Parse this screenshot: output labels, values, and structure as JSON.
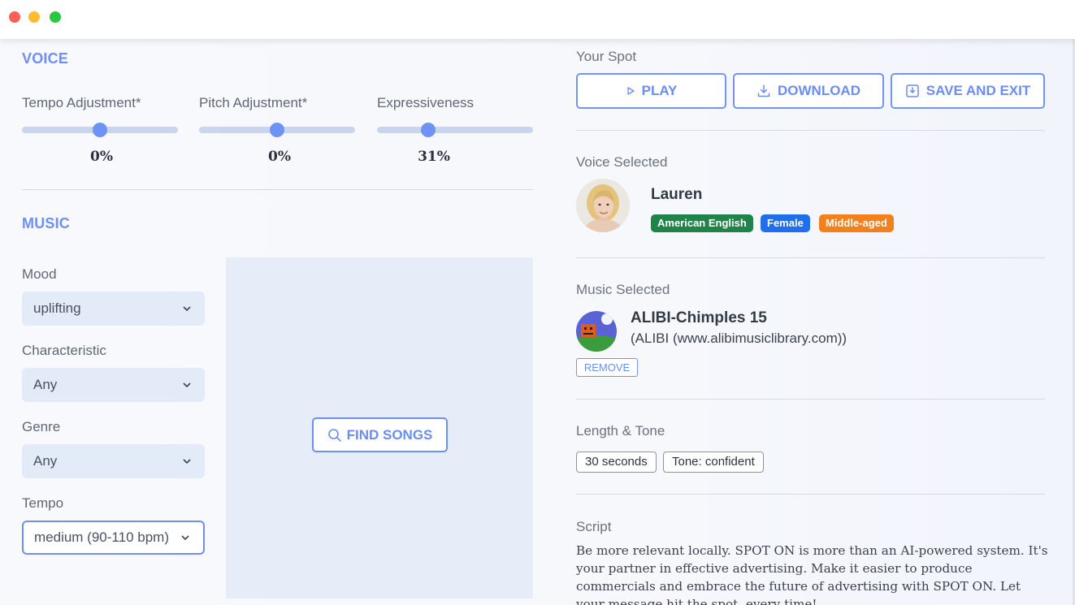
{
  "window": {
    "controls": [
      "close",
      "minimize",
      "maximize"
    ]
  },
  "voice": {
    "title": "VOICE",
    "sliders": [
      {
        "label": "Tempo Adjustment*",
        "value_text": "0%",
        "value": 0.5
      },
      {
        "label": "Pitch Adjustment*",
        "value_text": "0%",
        "value": 0.5
      },
      {
        "label": "Expressiveness",
        "value_text": "31%",
        "value": 0.33
      }
    ]
  },
  "music": {
    "title": "MUSIC",
    "fields": [
      {
        "label": "Mood",
        "value": "uplifting"
      },
      {
        "label": "Characteristic",
        "value": "Any"
      },
      {
        "label": "Genre",
        "value": "Any"
      },
      {
        "label": "Tempo",
        "value": "medium (90-110 bpm)"
      }
    ],
    "find_songs_label": "FIND SONGS"
  },
  "spot": {
    "title": "Your Spot",
    "play_label": "PLAY",
    "download_label": "DOWNLOAD",
    "save_label": "SAVE AND EXIT"
  },
  "voice_selected": {
    "label": "Voice Selected",
    "name": "Lauren",
    "tags": [
      {
        "text": "American English",
        "color": "#1e8449"
      },
      {
        "text": "Female",
        "color": "#1f6feb"
      },
      {
        "text": "Middle-aged",
        "color": "#f2801c"
      }
    ]
  },
  "music_selected": {
    "label": "Music Selected",
    "title": "ALIBI-Chimples 15",
    "source": "(ALIBI (www.alibimusiclibrary.com))",
    "remove_label": "REMOVE"
  },
  "length_tone": {
    "label": "Length & Tone",
    "length": "30 seconds",
    "tone": "Tone: confident"
  },
  "script": {
    "label": "Script",
    "text": "Be more relevant locally. SPOT ON is more than an AI-powered system. It's your partner in effective advertising. Make it easier to produce commercials and embrace the future of advertising with SPOT ON. Let your message hit the spot, every time!"
  },
  "colors": {
    "accent": "#6e8ff0",
    "section_title": "#6d8ff7",
    "slider_track": "#c9d5ec",
    "slider_thumb": "#6e93f6"
  }
}
